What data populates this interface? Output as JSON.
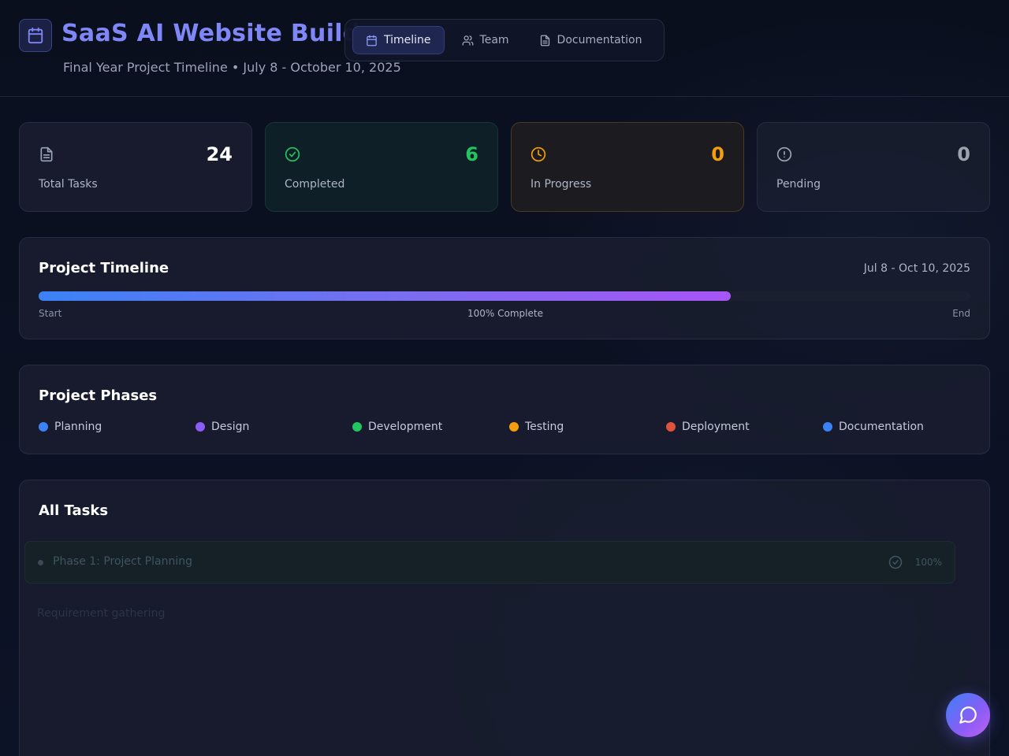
{
  "header": {
    "title": "SaaS AI Website Builder",
    "subtitle": "Final Year Project Timeline • July 8 - October 10, 2025"
  },
  "nav": {
    "tabs": [
      {
        "label": "Timeline",
        "icon": "calendar-icon",
        "active": true
      },
      {
        "label": "Team",
        "icon": "users-icon",
        "active": false
      },
      {
        "label": "Documentation",
        "icon": "file-text-icon",
        "active": false
      }
    ]
  },
  "stats": [
    {
      "label": "Total Tasks",
      "value": "24",
      "icon": "file-text-icon",
      "color": "#ffffff"
    },
    {
      "label": "Completed",
      "value": "6",
      "icon": "check-circle-icon",
      "color": "#22c55e"
    },
    {
      "label": "In Progress",
      "value": "0",
      "icon": "clock-icon",
      "color": "#f59e0b"
    },
    {
      "label": "Pending",
      "value": "0",
      "icon": "alert-circle-icon",
      "color": "#9ca3af"
    }
  ],
  "timeline": {
    "title": "Project Timeline",
    "date_range": "Jul 8 - Oct 10, 2025",
    "progress_fraction": 0.743,
    "start_label": "Start",
    "end_label": "End",
    "complete_label": "100% Complete"
  },
  "phases": {
    "title": "Project Phases",
    "items": [
      {
        "label": "Planning",
        "color": "#3b82f6"
      },
      {
        "label": "Design",
        "color": "#8b5cf6"
      },
      {
        "label": "Development",
        "color": "#22c55e"
      },
      {
        "label": "Testing",
        "color": "#f59e0b"
      },
      {
        "label": "Deployment",
        "color": "#e0533a"
      },
      {
        "label": "Documentation",
        "color": "#3b82f6"
      }
    ]
  },
  "tasks": {
    "title": "All Tasks",
    "rows": [
      {
        "title": "Phase 1: Project Planning",
        "percent": "100%"
      }
    ],
    "subtask": "Requirement gathering"
  },
  "chat": {
    "icon": "chat-bubble-icon"
  }
}
